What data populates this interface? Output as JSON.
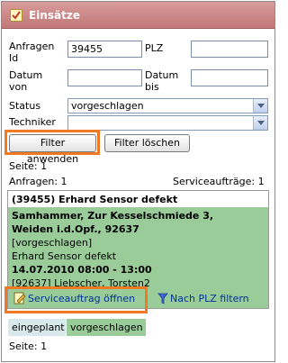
{
  "window": {
    "title": "Einsätze"
  },
  "filters": {
    "anfragen_id_label": "Anfragen Id",
    "anfragen_id_value": "39455",
    "plz_label": "PLZ",
    "plz_value": "",
    "datum_von_label": "Datum von",
    "datum_von_value": "",
    "datum_bis_label": "Datum bis",
    "datum_bis_value": "",
    "status_label": "Status",
    "status_value": "vorgeschlagen",
    "techniker_label": "Techniker",
    "techniker_value": ""
  },
  "buttons": {
    "apply_filter": "Filter anwenden",
    "clear_filter": "Filter löschen"
  },
  "paging": {
    "seite_top": "Seite: 1",
    "anfragen_count": "Anfragen: 1",
    "serviceauftraege_count": "Serviceaufträge: 1",
    "seite_bottom": "Seite: 1"
  },
  "card": {
    "header": "(39455) Erhard Sensor defekt",
    "address_line1": "Samhammer, Zur Kesselschmiede 3,",
    "address_line2": "Weiden i.d.Opf., 92637",
    "status": "[vorgeschlagen]",
    "description": "Erhard Sensor defekt",
    "datetime": "14.07.2010 08:00 - 13:00",
    "contact": "[92637] Liebscher, Torsten2",
    "open_action": "Serviceauftrag öffnen",
    "filter_action": "Nach PLZ filtern"
  },
  "tabs": {
    "eingeplant": "eingeplant",
    "vorgeschlagen": "vorgeschlagen"
  },
  "colors": {
    "titlebar": "#c98686",
    "card_green": "#99cc99",
    "highlight": "#f07a24",
    "tab_active": "#99cc99",
    "tab_inactive": "#d7e9ea"
  },
  "icons": {
    "app": "checklist-icon",
    "open": "edit-document-icon",
    "filter": "funnel-icon"
  }
}
